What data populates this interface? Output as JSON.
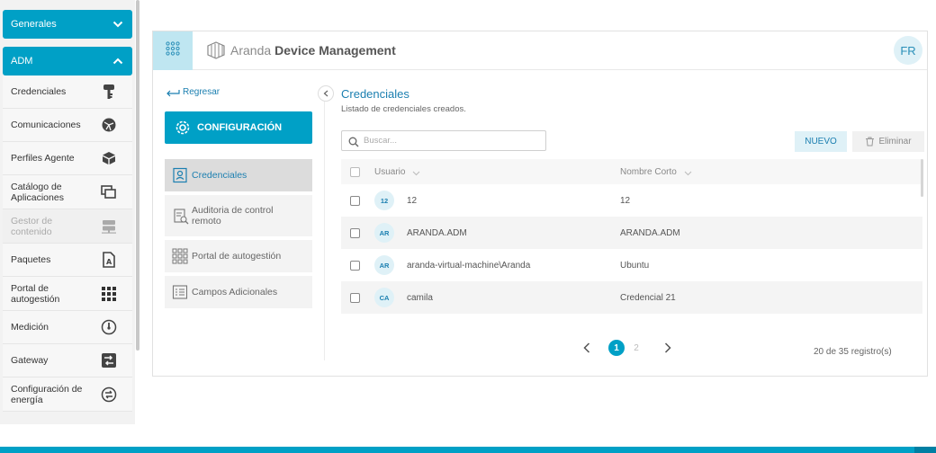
{
  "nav": {
    "group_general": "Generales",
    "group_adm": "ADM",
    "items": [
      {
        "label": "Credenciales",
        "icon": "key-icon",
        "disabled": false
      },
      {
        "label": "Comunicaciones",
        "icon": "network-globe-icon",
        "disabled": false
      },
      {
        "label": "Perfiles Agente",
        "icon": "boxes-icon",
        "disabled": false
      },
      {
        "label": "Catálogo de Aplicaciones",
        "icon": "stacked-windows-icon",
        "disabled": false
      },
      {
        "label": "Gestor de contenido",
        "icon": "server-icon",
        "disabled": true
      },
      {
        "label": "Paquetes",
        "icon": "package-doc-icon",
        "disabled": false
      },
      {
        "label": "Portal de autogestión",
        "icon": "grid-icon",
        "disabled": false
      },
      {
        "label": "Medición",
        "icon": "gauge-icon",
        "disabled": false
      },
      {
        "label": "Gateway",
        "icon": "gateway-icon",
        "disabled": false
      },
      {
        "label": "Configuración de energía",
        "icon": "energy-icon",
        "disabled": false
      }
    ]
  },
  "header": {
    "brand_light": "Aranda",
    "brand_strong": "Device Management",
    "user_initials": "FR"
  },
  "side": {
    "back_label": "Regresar",
    "config_label": "CONFIGURACIÓN",
    "menu": [
      {
        "label": "Credenciales",
        "icon": "id-card-icon",
        "active": true
      },
      {
        "label": "Auditoria de control remoto",
        "icon": "audit-icon",
        "active": false
      },
      {
        "label": "Portal de autogestión",
        "icon": "grid-outline-icon",
        "active": false
      },
      {
        "label": "Campos Adicionales",
        "icon": "form-list-icon",
        "active": false
      }
    ]
  },
  "content": {
    "title": "Credenciales",
    "subtitle": "Listado de credenciales creados.",
    "search_placeholder": "Buscar...",
    "new_label": "NUEVO",
    "delete_label": "Eliminar",
    "columns": {
      "user": "Usuario",
      "short_name": "Nombre Corto"
    },
    "rows": [
      {
        "initials": "12",
        "user": "12",
        "short": "12"
      },
      {
        "initials": "AR",
        "user": "ARANDA.ADM",
        "short": "ARANDA.ADM"
      },
      {
        "initials": "AR",
        "user": "aranda-virtual-machine\\Aranda",
        "short": "Ubuntu"
      },
      {
        "initials": "CA",
        "user": "camila",
        "short": "Credencial 21"
      }
    ],
    "pages": [
      "1",
      "2"
    ],
    "records": "20 de 35 registro(s)"
  },
  "colors": {
    "accent": "#00a0c6",
    "accent_light": "#dff1f7",
    "link": "#1b7fb0"
  }
}
